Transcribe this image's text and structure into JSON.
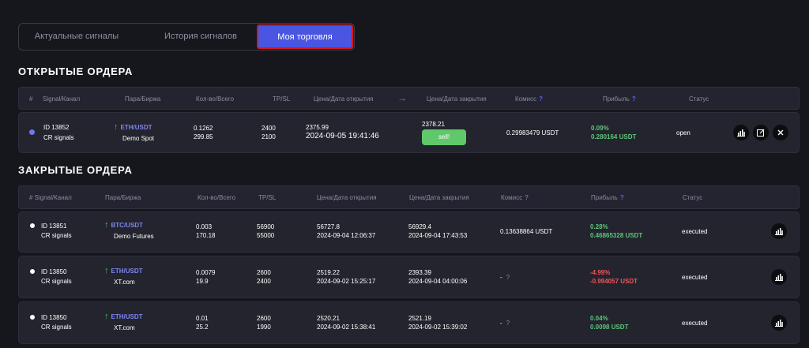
{
  "tabs": [
    {
      "label": "Актуальные сигналы"
    },
    {
      "label": "История сигналов"
    },
    {
      "label": "Моя торговля"
    }
  ],
  "open_orders": {
    "title": "ОТКРЫТЫЕ ОРДЕРА",
    "headers": {
      "num": "#",
      "signal": "Signal/Канал",
      "pair": "Пара/Биржа",
      "qty": "Кол-во/Всего",
      "tpsl": "TP/SL",
      "open": "Цена/Дата открытия",
      "arrow": "→",
      "close": "Цена/Дата закрытия",
      "commission": "Комисс",
      "commission_q": "?",
      "profit": "Прибыль",
      "profit_q": "?",
      "status": "Статус"
    },
    "rows": [
      {
        "id": "ID 13852",
        "channel": "CR signals",
        "pair": "ETH/USDT",
        "exchange": "Demo Spot",
        "qty": "0.1262",
        "total": "299.85",
        "tp": "2400",
        "sl": "2100",
        "open_price": "2375.99",
        "open_date": "2024-09-05 19:41:46",
        "close_price": "2378.21",
        "sell_label": "sell!",
        "commission": "0.29983479 USDT",
        "profit_pct": "0.09%",
        "profit_val": "0.280164 USDT",
        "status": "open"
      }
    ]
  },
  "closed_orders": {
    "title": "ЗАКРЫТЫЕ ОРДЕРА",
    "headers": {
      "signal": "# Signal/Канал",
      "pair": "Пара/Биржа",
      "qty": "Кол-во/Всего",
      "tpsl": "TP/SL",
      "open": "Цена/Дата открытия",
      "close": "Цена/Дата закрытия",
      "commission": "Комисс",
      "commission_q": "?",
      "profit": "Прибыль",
      "profit_q": "?",
      "status": "Статус"
    },
    "rows": [
      {
        "id": "ID 13851",
        "channel": "CR signals",
        "pair": "BTC/USDT",
        "exchange": "Demo Futures",
        "qty": "0.003",
        "total": "170.18",
        "tp": "56900",
        "sl": "55000",
        "open_price": "56727.8",
        "open_date": "2024-09-04 12:06:37",
        "close_price": "56929.4",
        "close_date": "2024-09-04 17:43:53",
        "commission": "0.13638864 USDT",
        "commission_q": "",
        "profit_pct": "0.28%",
        "profit_val": "0.46865328 USDT",
        "profit_sign": "positive",
        "status": "executed"
      },
      {
        "id": "ID 13850",
        "channel": "CR signals",
        "pair": "ETH/USDT",
        "exchange": "XT.com",
        "qty": "0.0079",
        "total": "19.9",
        "tp": "2600",
        "sl": "2400",
        "open_price": "2519.22",
        "open_date": "2024-09-02 15:25:17",
        "close_price": "2393.39",
        "close_date": "2024-09-04 04:00:06",
        "commission": "-",
        "commission_q": "?",
        "profit_pct": "-4.99%",
        "profit_val": "-0.994057 USDT",
        "profit_sign": "negative",
        "status": "executed"
      },
      {
        "id": "ID 13850",
        "channel": "CR signals",
        "pair": "ETH/USDT",
        "exchange": "XT.com",
        "qty": "0.01",
        "total": "25.2",
        "tp": "2600",
        "sl": "1990",
        "open_price": "2520.21",
        "open_date": "2024-09-02 15:38:41",
        "close_price": "2521.19",
        "close_date": "2024-09-02 15:39:02",
        "commission": "-",
        "commission_q": "?",
        "profit_pct": "0.04%",
        "profit_val": "0.0098 USDT",
        "profit_sign": "positive",
        "status": "executed"
      }
    ]
  },
  "icons": {
    "chart": "bar-chart-icon",
    "edit": "edit-icon",
    "close": "close-icon",
    "up": "arrow-up-icon"
  },
  "colors": {
    "accent": "#4a56e2",
    "positive": "#5dc67c",
    "negative": "#f0555b",
    "pair_link": "#7d86ef",
    "sell_button": "#5fc86a"
  }
}
